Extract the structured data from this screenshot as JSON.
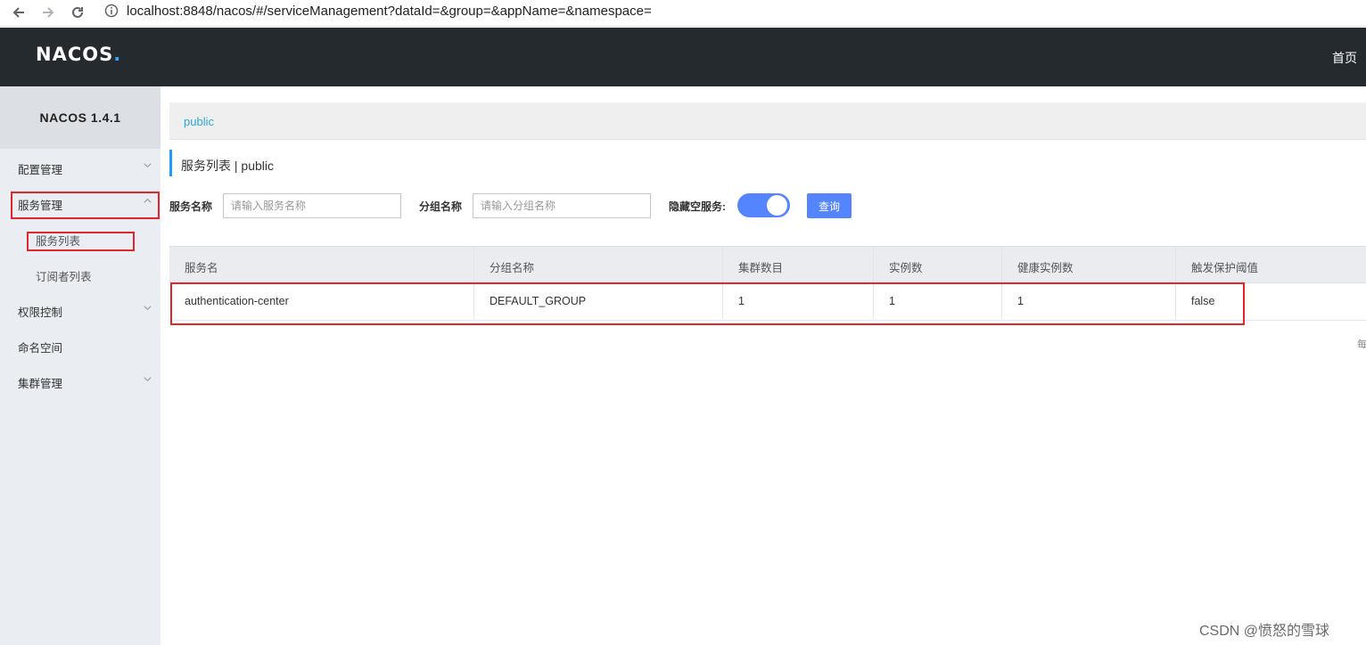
{
  "browser": {
    "url": "localhost:8848/nacos/#/serviceManagement?dataId=&group=&appName=&namespace="
  },
  "header": {
    "logo_main": "NACOS",
    "logo_dot": ".",
    "home_link": "首页"
  },
  "sidebar": {
    "version": "NACOS 1.4.1",
    "items": [
      {
        "label": "配置管理"
      },
      {
        "label": "服务管理"
      },
      {
        "label": "服务列表"
      },
      {
        "label": "订阅者列表"
      },
      {
        "label": "权限控制"
      },
      {
        "label": "命名空间"
      },
      {
        "label": "集群管理"
      }
    ]
  },
  "main": {
    "namespace_crumb": "public",
    "page_title": "服务列表  |  public",
    "filters": {
      "service_name_label": "服务名称",
      "service_name_placeholder": "请输入服务名称",
      "group_name_label": "分组名称",
      "group_name_placeholder": "请输入分组名称",
      "hide_empty_label": "隐藏空服务:",
      "hide_empty_on": true,
      "query_button": "查询"
    },
    "table": {
      "headers": [
        "服务名",
        "分组名称",
        "集群数目",
        "实例数",
        "健康实例数",
        "触发保护阈值"
      ],
      "rows": [
        [
          "authentication-center",
          "DEFAULT_GROUP",
          "1",
          "1",
          "1",
          "false"
        ]
      ]
    },
    "page_hint": "每"
  },
  "watermark": "CSDN @愤怒的雪球",
  "colors": {
    "header_bg": "#252a2f",
    "sidebar_bg": "#eaedf1",
    "accent": "#5584ff",
    "link": "#2aa8d6",
    "annotation_red": "#e0262a"
  }
}
